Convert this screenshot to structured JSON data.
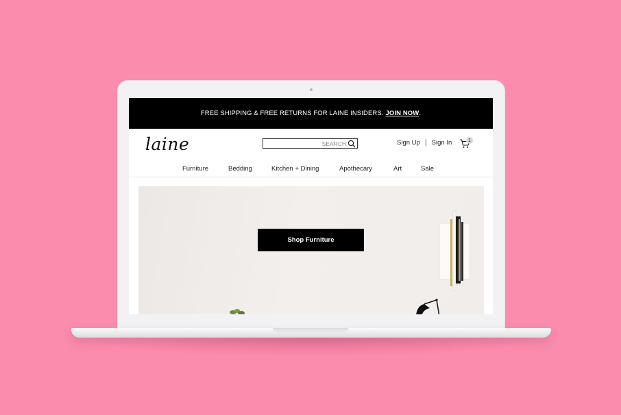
{
  "promo": {
    "text": "FREE SHIPPING & FREE RETURNS FOR LAINE INSIDERS.",
    "link": "JOIN NOW",
    "trail": "."
  },
  "header": {
    "logo": "laine",
    "search_placeholder": "SEARCH",
    "sign_up": "Sign Up",
    "separator": "|",
    "sign_in": "Sign In",
    "cart_count": "1"
  },
  "nav": {
    "items": [
      {
        "label": "Furniture"
      },
      {
        "label": "Bedding"
      },
      {
        "label": "Kitchen + Dining"
      },
      {
        "label": "Apothecary"
      },
      {
        "label": "Art"
      },
      {
        "label": "Sale"
      }
    ]
  },
  "hero": {
    "cta_label": "Shop Furniture"
  },
  "colors": {
    "background": "#fb8cae",
    "promo_bar": "#000000",
    "cta": "#000000"
  },
  "icons": [
    "search-icon",
    "cart-icon",
    "wall-sconce",
    "desk-lamp",
    "plant"
  ]
}
